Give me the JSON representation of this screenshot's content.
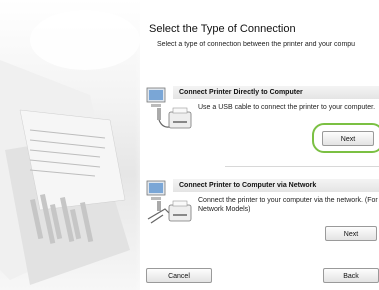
{
  "dialog": {
    "title": "Select the Type of Connection",
    "subtitle": "Select a type of connection between the printer and your compu"
  },
  "options": [
    {
      "heading": "Connect Printer Directly to Computer",
      "description": "Use a USB cable to connect the printer to your computer.",
      "next_label": "Next",
      "icon": "usb-printer-icon"
    },
    {
      "heading": "Connect Printer to Computer via Network",
      "description": "Connect the printer to your computer via the network. (For Network Models)",
      "next_label": "Next",
      "icon": "network-printer-icon"
    }
  ],
  "footer": {
    "cancel_label": "Cancel",
    "back_label": "Back"
  },
  "colors": {
    "highlight": "#7bc043"
  }
}
